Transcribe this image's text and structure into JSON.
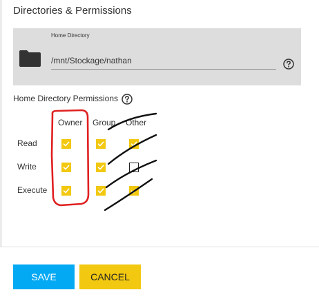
{
  "section": {
    "title": "Directories & Permissions"
  },
  "home_directory": {
    "label": "Home Directory",
    "value": "/mnt/Stockage/nathan",
    "icon": "folder-icon",
    "help_icon": "help-circle-icon"
  },
  "permissions": {
    "title": "Home Directory Permissions",
    "help_icon": "help-circle-icon",
    "columns": [
      "Owner",
      "Group",
      "Other"
    ],
    "rows": [
      {
        "label": "Read",
        "owner": true,
        "group": true,
        "other": true
      },
      {
        "label": "Write",
        "owner": true,
        "group": true,
        "other": false
      },
      {
        "label": "Execute",
        "owner": true,
        "group": true,
        "other": true
      }
    ]
  },
  "actions": {
    "save_label": "SAVE",
    "cancel_label": "CANCEL"
  },
  "colors": {
    "save_button": "#04a9f4",
    "cancel_button": "#f2c811",
    "checkbox_checked": "#f2c811",
    "annotation_red": "#e02020"
  }
}
